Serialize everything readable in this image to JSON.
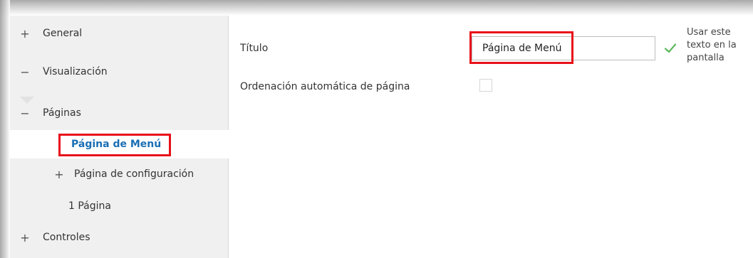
{
  "sidebar": {
    "items": [
      {
        "symbol": "+",
        "label": "General",
        "state": "collapsed"
      },
      {
        "symbol": "−",
        "label": "Visualización",
        "state": "expanded"
      },
      {
        "symbol": "−",
        "label": "Páginas",
        "state": "expanded"
      },
      {
        "symbol": "",
        "label": "Página de Menú",
        "state": "selected"
      },
      {
        "symbol": "+",
        "label": "Página de configuración",
        "state": "collapsed"
      },
      {
        "symbol": "",
        "label": "1 Página",
        "state": "leaf"
      },
      {
        "symbol": "+",
        "label": "Controles",
        "state": "collapsed"
      }
    ]
  },
  "main": {
    "title_label": "Título",
    "title_value": "Página de Menú",
    "use_text_checked": true,
    "use_text_label_lines": [
      "Usar este",
      "texto en la",
      "pantalla"
    ],
    "auto_order_label": "Ordenación automática de página",
    "auto_order_checked": false
  },
  "colors": {
    "highlight_box": "#e8101a",
    "selected_text": "#1a6fb4",
    "check": "#5cb85c",
    "sidebar_bg": "#f0f0f0"
  },
  "icons": {
    "check": "check-icon",
    "expand": "plus-icon",
    "collapse": "minus-icon"
  }
}
